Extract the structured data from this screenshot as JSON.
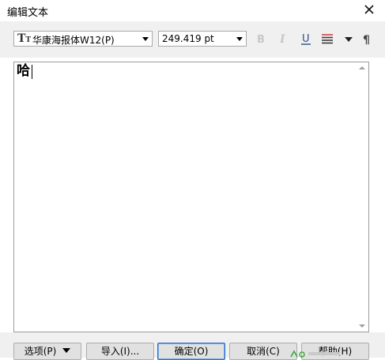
{
  "window": {
    "title": "编辑文本"
  },
  "toolbar": {
    "font_name": "华康海报体W12(P)",
    "font_size": "249.419 pt",
    "bold_label": "B",
    "italic_label": "I",
    "underline_label": "U",
    "paragraph_label": "¶"
  },
  "editor": {
    "text": "哈"
  },
  "buttons": {
    "options": "选项(P)",
    "import": "导入(I)...",
    "ok": "确定(O)",
    "cancel": "取消(C)",
    "help": "帮助(H)"
  },
  "icons": {
    "font_type": "font-type-icon",
    "bold": "bold-icon",
    "italic": "italic-icon",
    "underline": "underline-icon",
    "align": "align-icon",
    "paragraph": "paragraph-icon",
    "close": "close-icon"
  },
  "colors": {
    "default_button_border": "#2b6fc7",
    "align_icon_red": "#d04040"
  }
}
